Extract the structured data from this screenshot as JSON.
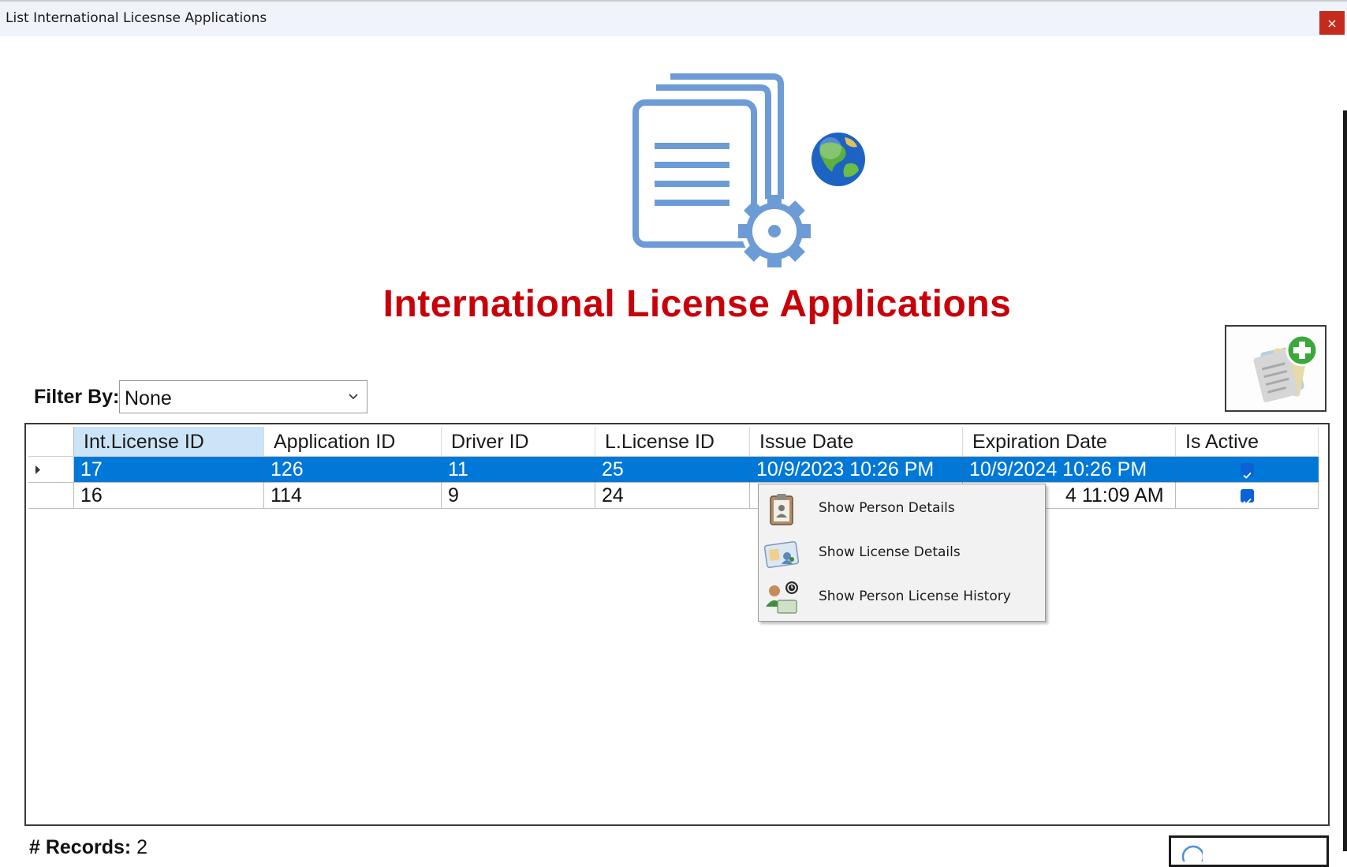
{
  "window": {
    "title": "List International Licesnse Applications",
    "close_glyph": "×",
    "close_color": "#c42b1c"
  },
  "header": {
    "title": "International License Applications",
    "title_color": "#c8000a",
    "hero_icon": "documents-gear-globe-icon"
  },
  "toolbar": {
    "add_icon": "add-application-icon"
  },
  "filter": {
    "label": "Filter By:",
    "value": "None"
  },
  "grid": {
    "columns": [
      "Int.License ID",
      "Application ID",
      "Driver ID",
      "L.License ID",
      "Issue Date",
      "Expiration Date",
      "Is Active"
    ],
    "rows": [
      {
        "int_license_id": "17",
        "application_id": "126",
        "driver_id": "11",
        "l_license_id": "25",
        "issue_date": "10/9/2023 10:26 PM",
        "expiration_date": "10/9/2024 10:26 PM",
        "is_active": true,
        "selected": true
      },
      {
        "int_license_id": "16",
        "application_id": "114",
        "driver_id": "9",
        "l_license_id": "24",
        "issue_date": "1",
        "expiration_date": "4 11:09 AM",
        "is_active": true,
        "selected": false
      }
    ],
    "selection_color": "#0078d7"
  },
  "context_menu": {
    "items": [
      {
        "label": "Show Person Details",
        "icon": "person-card-icon"
      },
      {
        "label": "Show License Details",
        "icon": "license-card-icon"
      },
      {
        "label": "Show Person License History",
        "icon": "person-history-icon"
      }
    ]
  },
  "footer": {
    "records_label": "# Records:",
    "records_count": "2"
  }
}
